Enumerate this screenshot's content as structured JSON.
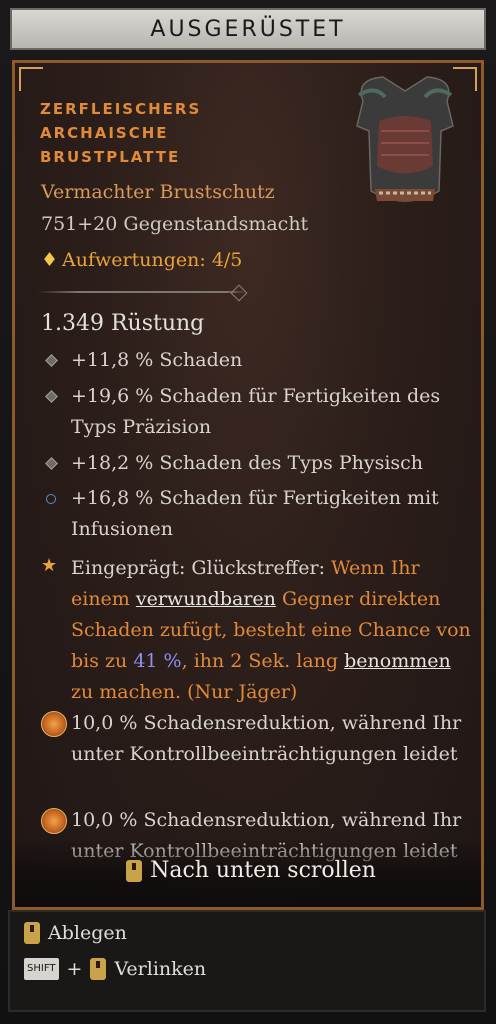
{
  "header": {
    "title": "AUSGERÜSTET"
  },
  "item": {
    "name_lines": [
      "ZERFLEISCHERS",
      "ARCHAISCHE",
      "BRUSTPLATTE"
    ],
    "type": "Vermachter Brustschutz",
    "power": "751+20 Gegenstandsmacht",
    "upgrades": "Aufwertungen: 4/5",
    "armor": "1.349 Rüstung",
    "affixes": [
      "+11,8 % Schaden",
      "+19,6 % Schaden für Fertigkeiten des Typs Präzision",
      "+18,2 % Schaden des Typs Physisch",
      "+16,8 % Schaden für Fertigkeiten mit Infusionen"
    ],
    "legendary": {
      "prefix": "Eingeprägt: Glückstreffer:",
      "t1": "Wenn Ihr einem",
      "link1": "verwundbaren",
      "t2": "Gegner direkten Schaden zufügt, besteht eine Chance von bis zu",
      "pct": "41 %",
      "t3": ", ihn 2 Sek. lang",
      "link2": "benommen",
      "t4": "zu machen. (Nur Jäger)"
    },
    "aspects": [
      "10,0 % Schadensreduktion, während Ihr unter Kontrollbeeinträchtigungen leidet",
      "10,0 % Schadensreduktion, während Ihr unter Kontrollbeeinträchtigungen leidet"
    ]
  },
  "scroll_hint": "Nach unten scrollen",
  "footer": {
    "drop_label": "Ablegen",
    "shift_label": "SHIFT",
    "plus": "+",
    "link_label": "Verlinken"
  },
  "colors": {
    "legendary_orange": "#e08a3a",
    "affix_gray": "#d8d4cd",
    "frame_bronze": "#8e5a2c"
  },
  "icons": [
    "diamond-bullet-icon",
    "circle-bullet-icon",
    "star-icon",
    "aspect-icon",
    "mouse-icon",
    "shift-key-icon"
  ]
}
